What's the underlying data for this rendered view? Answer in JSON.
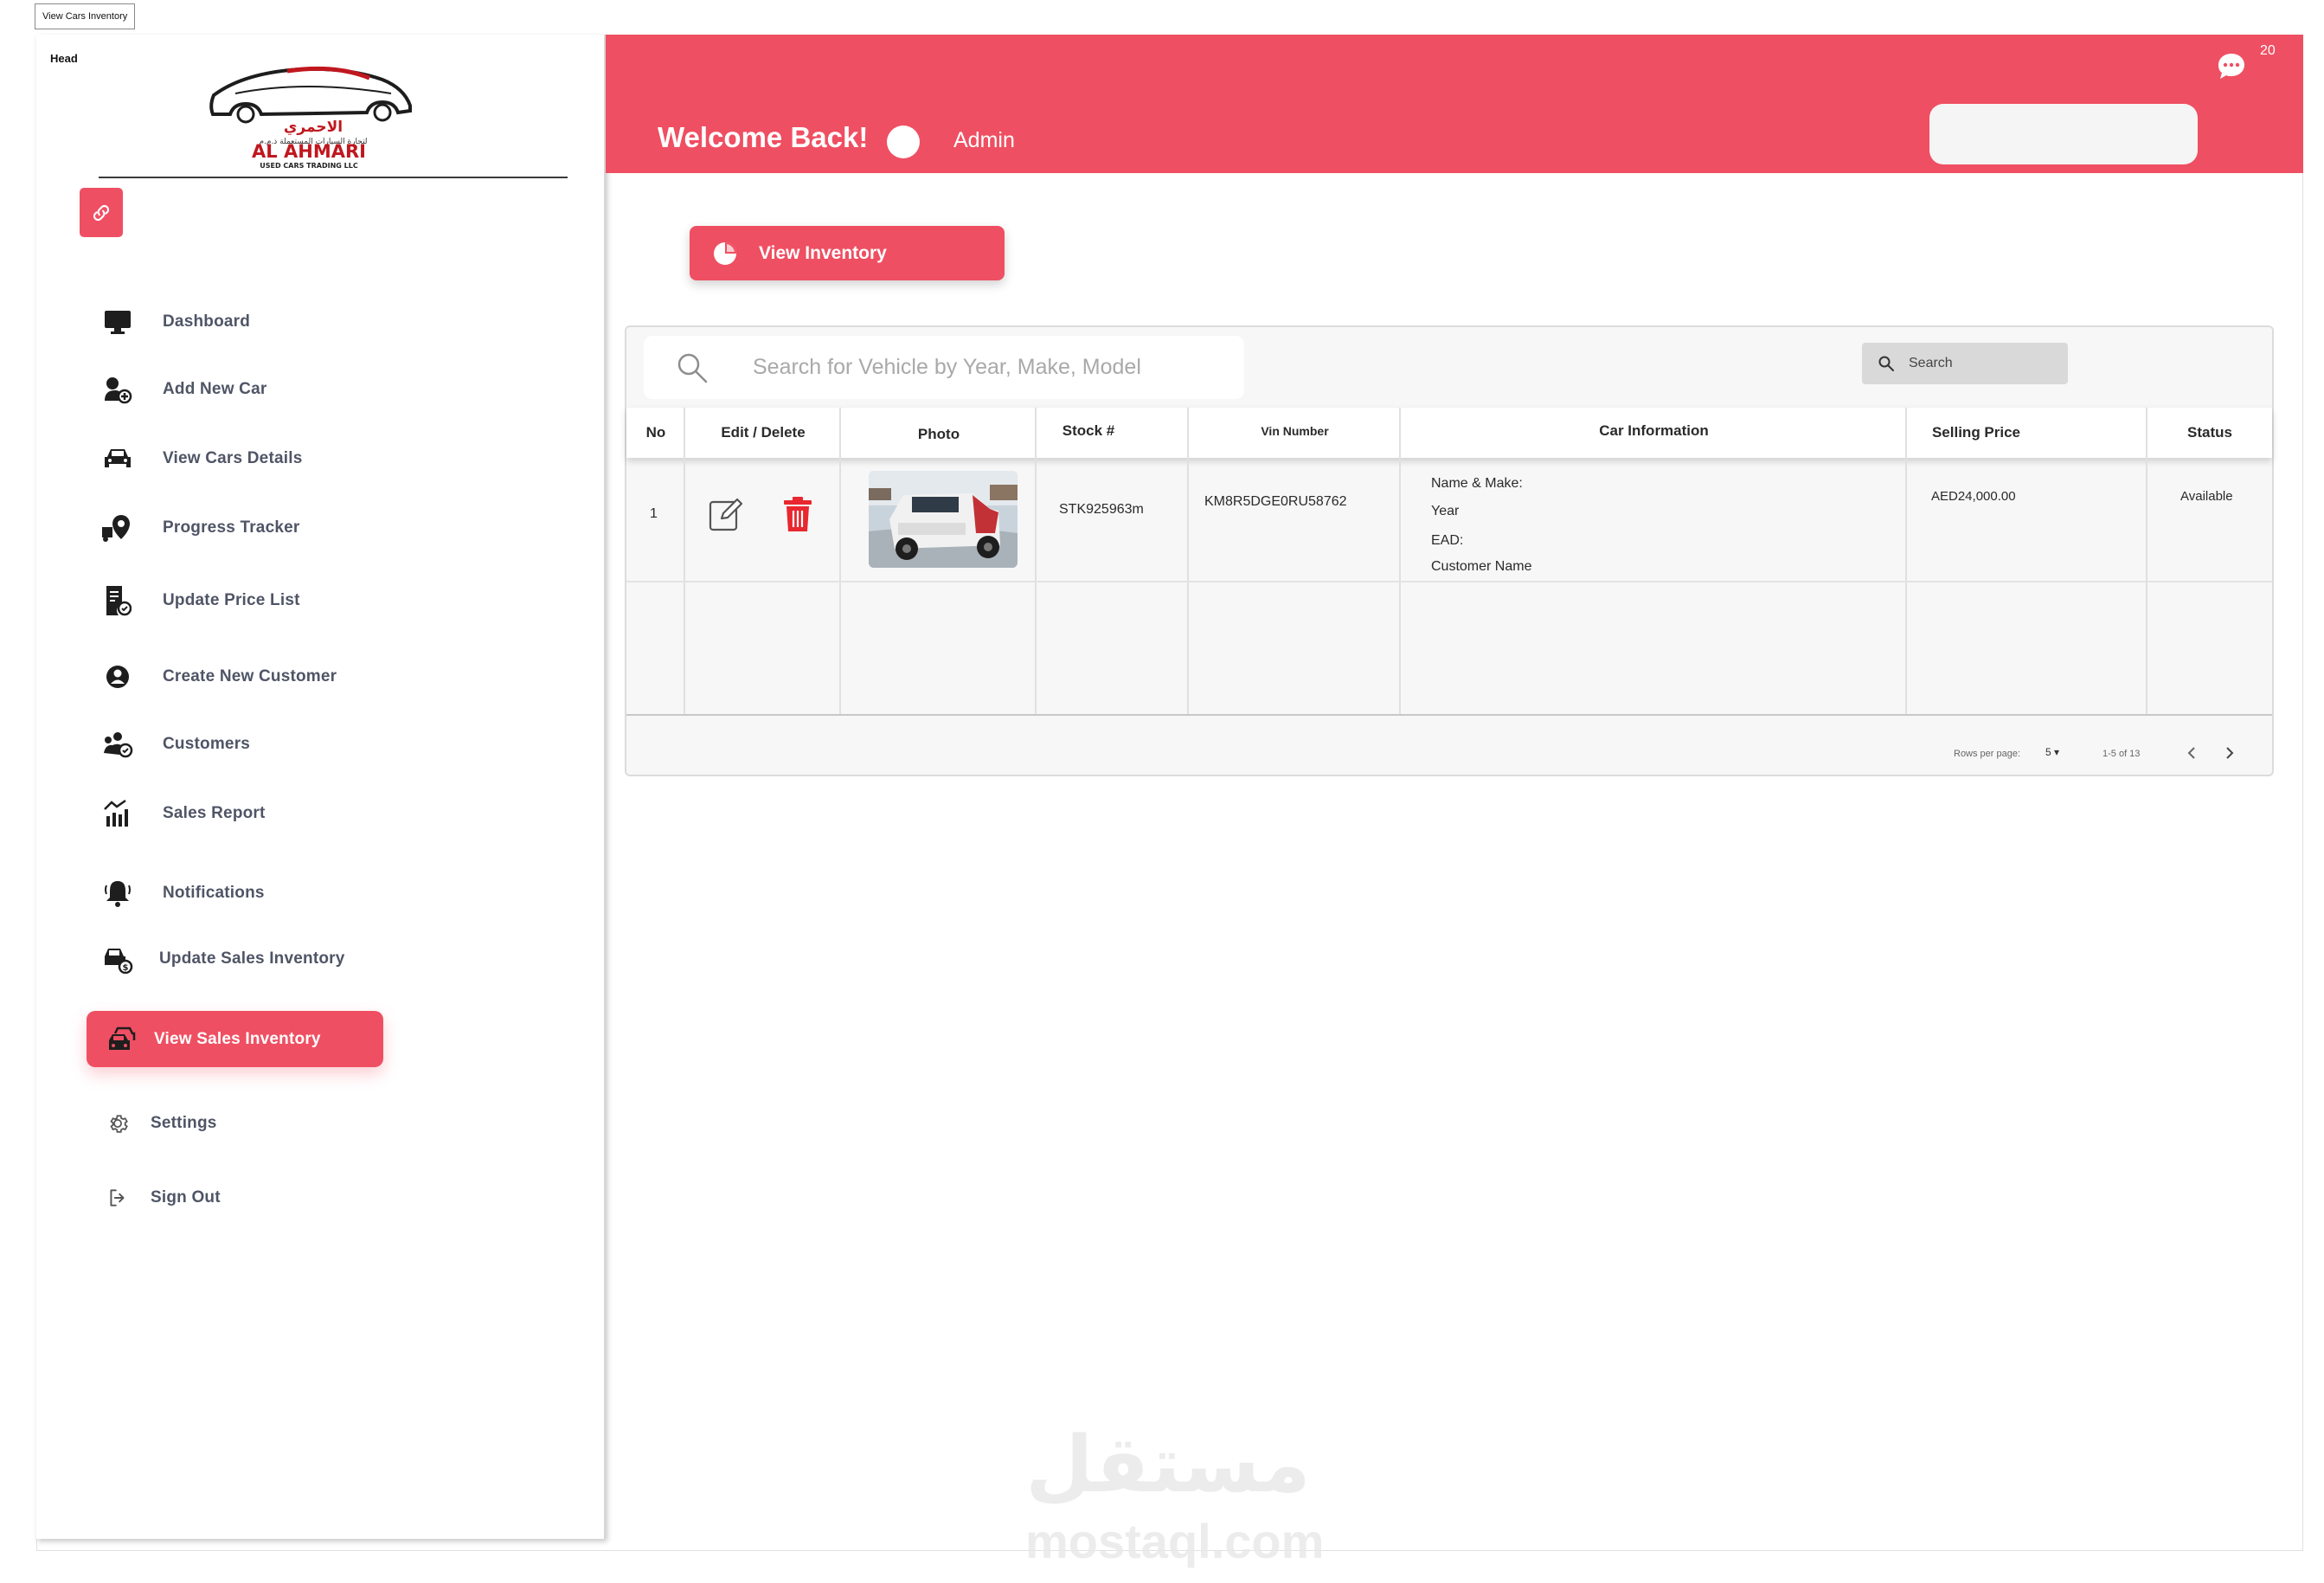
{
  "page_tab": "View Cars Inventory",
  "sidebar": {
    "head_label": "Head",
    "logo": {
      "arabic": "الاحمري",
      "arabic_sub": "لتجارة السيارات المستعملة ذ.م.م",
      "brand": "AL AHMARI",
      "tagline": "USED CARS TRADING LLC"
    },
    "items": [
      {
        "label": "Dashboard",
        "icon": "monitor-icon"
      },
      {
        "label": "Add New Car",
        "icon": "add-car-icon"
      },
      {
        "label": "View Cars Details",
        "icon": "car-icon"
      },
      {
        "label": "Progress Tracker",
        "icon": "tracker-icon"
      },
      {
        "label": "Update Price List",
        "icon": "price-list-icon"
      },
      {
        "label": "Create New Customer",
        "icon": "user-icon"
      },
      {
        "label": "Customers",
        "icon": "customers-icon"
      },
      {
        "label": "Sales Report",
        "icon": "sales-report-icon"
      },
      {
        "label": "Notifications",
        "icon": "bell-icon"
      },
      {
        "label": "Update Sales Inventory",
        "icon": "car-dollar-icon"
      },
      {
        "label": "View Sales Inventory",
        "icon": "cars-icon",
        "active": true
      },
      {
        "label": "Settings",
        "icon": "gear-icon"
      },
      {
        "label": "Sign Out",
        "icon": "sign-out-icon"
      }
    ]
  },
  "header": {
    "welcome": "Welcome Back!",
    "role": "Admin",
    "chat_count": "20"
  },
  "main": {
    "view_inventory_label": "View Inventory",
    "search_placeholder": "Search for Vehicle by Year, Make, Model",
    "search_button": "Search",
    "columns": [
      "No",
      "Edit / Delete",
      "Photo",
      "Stock #",
      "Vin Number",
      "Car Information",
      "Selling Price",
      "Status"
    ],
    "rows": [
      {
        "no": "1",
        "stock": "STK925963m",
        "vin": "KM8R5DGE0RU58762",
        "info": [
          "Name & Make:",
          "Year",
          "EAD:",
          "Customer Name"
        ],
        "price": "AED24,000.00",
        "status": "Available"
      }
    ],
    "pagination": {
      "rows_label": "Rows per page:",
      "rows_value": "5",
      "range": "1-5 of 13"
    }
  },
  "watermark": {
    "arabic": "مستقل",
    "latin": "mostaql.com"
  },
  "colors": {
    "accent": "#ef4f62",
    "delete": "#e8272e",
    "sidebar_text": "#4f5566"
  }
}
